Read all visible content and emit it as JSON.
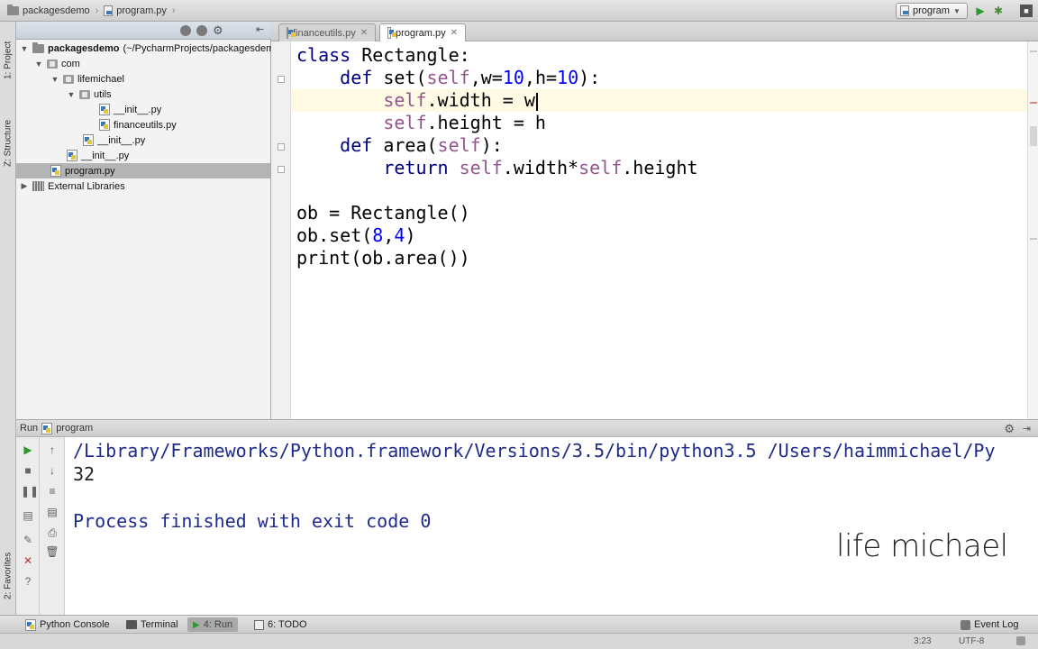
{
  "navbar": {
    "crumb_project": "packagesdemo",
    "crumb_file": "program.py",
    "run_config": "program"
  },
  "leftstrip": {
    "project_label": "1: Project",
    "structure_label": "Z: Structure",
    "favorites_label": "2: Favorites"
  },
  "project_tree": {
    "root": "packagesdemo",
    "root_path": "(~/PycharmProjects/packagesdemo)",
    "items": [
      {
        "label": "com"
      },
      {
        "label": "lifemichael"
      },
      {
        "label": "utils"
      },
      {
        "label": "__init__.py"
      },
      {
        "label": "financeutils.py"
      },
      {
        "label": "__init__.py"
      },
      {
        "label": "__init__.py"
      },
      {
        "label": "program.py"
      },
      {
        "label": "External Libraries"
      }
    ]
  },
  "editor": {
    "tabs": [
      {
        "label": "financeutils.py"
      },
      {
        "label": "program.py"
      }
    ],
    "code": {
      "l1_kw": "class",
      "l1_rest": " Rectangle:",
      "l2_kw": "def",
      "l2_name": " set(",
      "l2_self": "self",
      "l2_a": ",w=",
      "l2_n1": "10",
      "l2_b": ",h=",
      "l2_n2": "10",
      "l2_c": "):",
      "l3_self": "self",
      "l3_rest": ".width = w",
      "l4_self": "self",
      "l4_rest": ".height = h",
      "l5_kw": "def",
      "l5_name": " area(",
      "l5_self": "self",
      "l5_c": "):",
      "l6_kw": "return",
      "l6_self1": "self",
      "l6_mid": ".width*",
      "l6_self2": "self",
      "l6_end": ".height",
      "l8": "ob = Rectangle()",
      "l9_a": "ob.set(",
      "l9_n1": "8",
      "l9_comma": ",",
      "l9_n2": "4",
      "l9_b": ")",
      "l10": "print(ob.area())"
    }
  },
  "run_panel": {
    "header_label": "Run",
    "config_label": "program",
    "console": {
      "command": "/Library/Frameworks/Python.framework/Versions/3.5/bin/python3.5 /Users/haimmichael/Py",
      "output": "32",
      "finished": "Process finished with exit code 0"
    }
  },
  "watermark": "life michael",
  "bottombar": {
    "python_console": "Python Console",
    "terminal": "Terminal",
    "run": "4: Run",
    "todo": "6: TODO",
    "event_log": "Event Log"
  },
  "statusbar": {
    "position": "3:23",
    "encoding": "UTF-8"
  }
}
